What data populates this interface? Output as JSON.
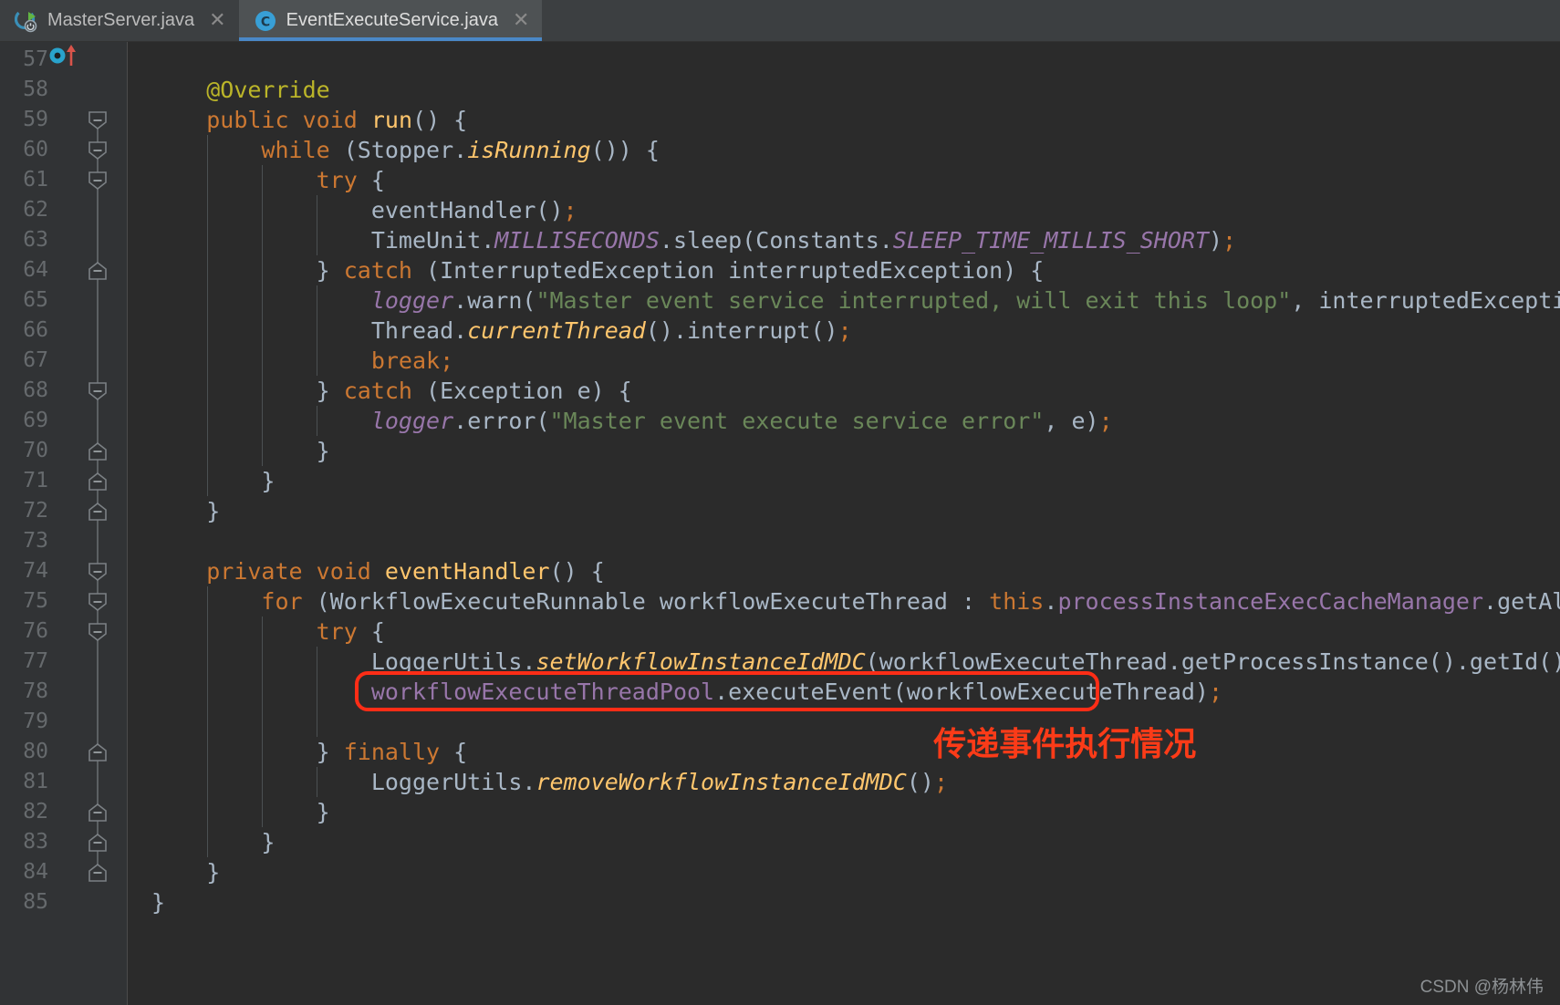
{
  "window": {
    "app": "IntelliJ IDEA Java Editor",
    "background_color": "#2b2b2b",
    "gutter_color": "#313335"
  },
  "tabs": [
    {
      "label": "MasterServer.java",
      "icon": "java-class-runnable-icon",
      "active": false,
      "close_glyph": "✕"
    },
    {
      "label": "EventExecuteService.java",
      "icon": "java-class-icon",
      "active": true,
      "close_glyph": "✕"
    }
  ],
  "gutter": {
    "override_marker_name": "overridden-method-marker",
    "first_line": 57,
    "last_line": 85,
    "line_numbers": [
      57,
      58,
      59,
      60,
      61,
      62,
      63,
      64,
      65,
      66,
      67,
      68,
      69,
      70,
      71,
      72,
      73,
      74,
      75,
      76,
      77,
      78,
      79,
      80,
      81,
      82,
      83,
      84,
      85
    ]
  },
  "annotation": {
    "text": "传递事件执行情况",
    "color": "#fb3b18",
    "box_color": "#ff2d16",
    "boxed_line": 78
  },
  "watermark": {
    "text": "CSDN @杨林伟"
  },
  "colors": {
    "keyword": "#cc7832",
    "annotation_token": "#bbb529",
    "method": "#ffc66d",
    "field": "#9876aa",
    "string": "#6a8759",
    "default_text": "#a9b7c6",
    "line_number": "#666a6d",
    "tab_active_underline": "#4a88c7"
  },
  "code_lines": [
    {
      "n": 57,
      "indent": 0,
      "tokens": []
    },
    {
      "n": 58,
      "indent": 0,
      "tokens": [
        {
          "t": "    ",
          "c": "def"
        },
        {
          "t": "@Override",
          "c": "ann"
        }
      ]
    },
    {
      "n": 59,
      "indent": 0,
      "tokens": [
        {
          "t": "    ",
          "c": "def"
        },
        {
          "t": "public",
          "c": "kw"
        },
        {
          "t": " ",
          "c": "def"
        },
        {
          "t": "void",
          "c": "kw"
        },
        {
          "t": " ",
          "c": "def"
        },
        {
          "t": "run",
          "c": "meth"
        },
        {
          "t": "() {",
          "c": "def"
        }
      ]
    },
    {
      "n": 60,
      "indent": 0,
      "tokens": [
        {
          "t": "        ",
          "c": "def"
        },
        {
          "t": "while",
          "c": "kw"
        },
        {
          "t": " (Stopper.",
          "c": "def"
        },
        {
          "t": "isRunning",
          "c": "smeth"
        },
        {
          "t": "()) {",
          "c": "def"
        }
      ]
    },
    {
      "n": 61,
      "indent": 0,
      "tokens": [
        {
          "t": "            ",
          "c": "def"
        },
        {
          "t": "try",
          "c": "kw"
        },
        {
          "t": " {",
          "c": "def"
        }
      ]
    },
    {
      "n": 62,
      "indent": 0,
      "tokens": [
        {
          "t": "                eventHandler()",
          "c": "def"
        },
        {
          "t": ";",
          "c": "sem"
        }
      ]
    },
    {
      "n": 63,
      "indent": 0,
      "tokens": [
        {
          "t": "                TimeUnit.",
          "c": "def"
        },
        {
          "t": "MILLISECONDS",
          "c": "sfld"
        },
        {
          "t": ".sleep(Constants.",
          "c": "def"
        },
        {
          "t": "SLEEP_TIME_MILLIS_SHORT",
          "c": "sfld"
        },
        {
          "t": ")",
          "c": "def"
        },
        {
          "t": ";",
          "c": "sem"
        }
      ]
    },
    {
      "n": 64,
      "indent": 0,
      "tokens": [
        {
          "t": "            } ",
          "c": "def"
        },
        {
          "t": "catch",
          "c": "kw"
        },
        {
          "t": " (InterruptedException interruptedException) {",
          "c": "def"
        }
      ]
    },
    {
      "n": 65,
      "indent": 0,
      "tokens": [
        {
          "t": "                ",
          "c": "def"
        },
        {
          "t": "logger",
          "c": "sfld"
        },
        {
          "t": ".warn(",
          "c": "def"
        },
        {
          "t": "\"Master event service interrupted, will exit this loop\"",
          "c": "str"
        },
        {
          "t": ", interruptedException)",
          "c": "def"
        },
        {
          "t": ";",
          "c": "sem"
        }
      ]
    },
    {
      "n": 66,
      "indent": 0,
      "tokens": [
        {
          "t": "                Thread.",
          "c": "def"
        },
        {
          "t": "currentThread",
          "c": "smeth"
        },
        {
          "t": "().interrupt()",
          "c": "def"
        },
        {
          "t": ";",
          "c": "sem"
        }
      ]
    },
    {
      "n": 67,
      "indent": 0,
      "tokens": [
        {
          "t": "                ",
          "c": "def"
        },
        {
          "t": "break",
          "c": "kw"
        },
        {
          "t": ";",
          "c": "sem"
        }
      ]
    },
    {
      "n": 68,
      "indent": 0,
      "tokens": [
        {
          "t": "            } ",
          "c": "def"
        },
        {
          "t": "catch",
          "c": "kw"
        },
        {
          "t": " (Exception e) {",
          "c": "def"
        }
      ]
    },
    {
      "n": 69,
      "indent": 0,
      "tokens": [
        {
          "t": "                ",
          "c": "def"
        },
        {
          "t": "logger",
          "c": "sfld"
        },
        {
          "t": ".error(",
          "c": "def"
        },
        {
          "t": "\"Master event execute service error\"",
          "c": "str"
        },
        {
          "t": ", e)",
          "c": "def"
        },
        {
          "t": ";",
          "c": "sem"
        }
      ]
    },
    {
      "n": 70,
      "indent": 0,
      "tokens": [
        {
          "t": "            }",
          "c": "def"
        }
      ]
    },
    {
      "n": 71,
      "indent": 0,
      "tokens": [
        {
          "t": "        }",
          "c": "def"
        }
      ]
    },
    {
      "n": 72,
      "indent": 0,
      "tokens": [
        {
          "t": "    }",
          "c": "def"
        }
      ]
    },
    {
      "n": 73,
      "indent": 0,
      "tokens": []
    },
    {
      "n": 74,
      "indent": 0,
      "tokens": [
        {
          "t": "    ",
          "c": "def"
        },
        {
          "t": "private",
          "c": "kw"
        },
        {
          "t": " ",
          "c": "def"
        },
        {
          "t": "void",
          "c": "kw"
        },
        {
          "t": " ",
          "c": "def"
        },
        {
          "t": "eventHandler",
          "c": "meth"
        },
        {
          "t": "() {",
          "c": "def"
        }
      ]
    },
    {
      "n": 75,
      "indent": 0,
      "tokens": [
        {
          "t": "        ",
          "c": "def"
        },
        {
          "t": "for",
          "c": "kw"
        },
        {
          "t": " (WorkflowExecuteRunnable workflowExecuteThread : ",
          "c": "def"
        },
        {
          "t": "this",
          "c": "kw"
        },
        {
          "t": ".",
          "c": "def"
        },
        {
          "t": "processInstanceExecCacheManager",
          "c": "fld"
        },
        {
          "t": ".getAll()) {",
          "c": "def"
        }
      ]
    },
    {
      "n": 76,
      "indent": 0,
      "tokens": [
        {
          "t": "            ",
          "c": "def"
        },
        {
          "t": "try",
          "c": "kw"
        },
        {
          "t": " {",
          "c": "def"
        }
      ]
    },
    {
      "n": 77,
      "indent": 0,
      "tokens": [
        {
          "t": "                LoggerUtils.",
          "c": "def"
        },
        {
          "t": "setWorkflowInstanceIdMDC",
          "c": "smeth"
        },
        {
          "t": "(workflowExecuteThread.getProcessInstance().getId())",
          "c": "def"
        },
        {
          "t": ";",
          "c": "sem"
        }
      ]
    },
    {
      "n": 78,
      "indent": 0,
      "tokens": [
        {
          "t": "                ",
          "c": "def"
        },
        {
          "t": "workflowExecuteThreadPool",
          "c": "fld"
        },
        {
          "t": ".executeEvent(workflowExecuteThread)",
          "c": "def"
        },
        {
          "t": ";",
          "c": "sem"
        }
      ]
    },
    {
      "n": 79,
      "indent": 0,
      "tokens": []
    },
    {
      "n": 80,
      "indent": 0,
      "tokens": [
        {
          "t": "            } ",
          "c": "def"
        },
        {
          "t": "finally",
          "c": "kw"
        },
        {
          "t": " {",
          "c": "def"
        }
      ]
    },
    {
      "n": 81,
      "indent": 0,
      "tokens": [
        {
          "t": "                LoggerUtils.",
          "c": "def"
        },
        {
          "t": "removeWorkflowInstanceIdMDC",
          "c": "smeth"
        },
        {
          "t": "()",
          "c": "def"
        },
        {
          "t": ";",
          "c": "sem"
        }
      ]
    },
    {
      "n": 82,
      "indent": 0,
      "tokens": [
        {
          "t": "            }",
          "c": "def"
        }
      ]
    },
    {
      "n": 83,
      "indent": 0,
      "tokens": [
        {
          "t": "        }",
          "c": "def"
        }
      ]
    },
    {
      "n": 84,
      "indent": 0,
      "tokens": [
        {
          "t": "    }",
          "c": "def"
        }
      ]
    },
    {
      "n": 85,
      "indent": 0,
      "tokens": [
        {
          "t": "}",
          "c": "def"
        }
      ]
    }
  ],
  "fold_markers": [
    {
      "line": 59,
      "type": "start"
    },
    {
      "line": 60,
      "type": "start"
    },
    {
      "line": 61,
      "type": "start"
    },
    {
      "line": 64,
      "type": "end"
    },
    {
      "line": 68,
      "type": "start"
    },
    {
      "line": 70,
      "type": "end"
    },
    {
      "line": 71,
      "type": "end"
    },
    {
      "line": 72,
      "type": "end"
    },
    {
      "line": 74,
      "type": "start"
    },
    {
      "line": 75,
      "type": "start"
    },
    {
      "line": 76,
      "type": "start"
    },
    {
      "line": 80,
      "type": "end"
    },
    {
      "line": 82,
      "type": "end"
    },
    {
      "line": 83,
      "type": "end"
    },
    {
      "line": 84,
      "type": "end"
    }
  ]
}
